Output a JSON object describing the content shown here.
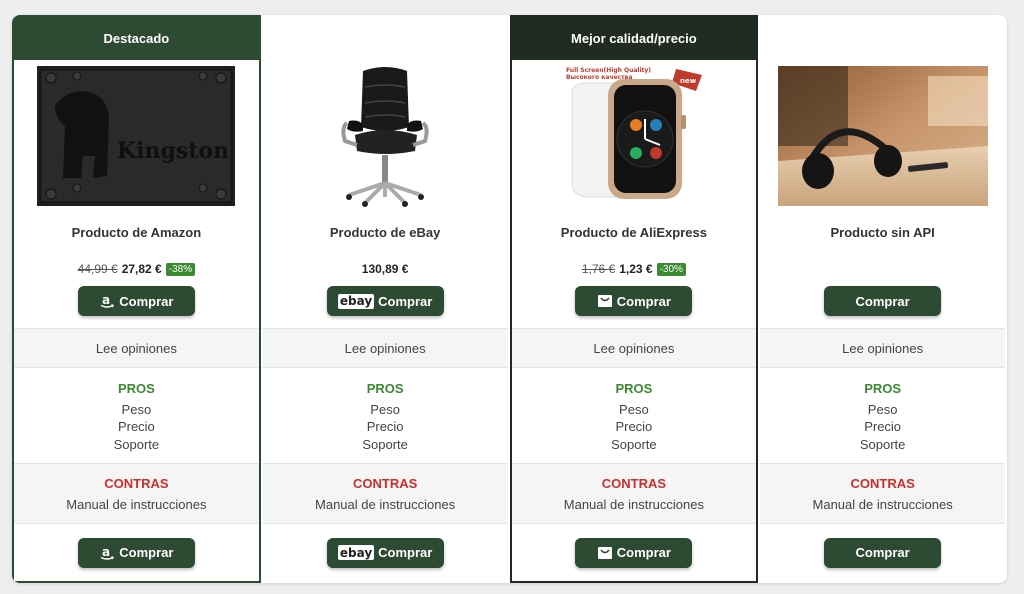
{
  "columns": [
    {
      "badge": "Destacado",
      "title": "Producto de Amazon",
      "old_price": "44,99 €",
      "price": "27,82 €",
      "discount": "-38%",
      "buy_label": "Comprar",
      "store_icon": "amazon-icon",
      "reviews": "Lee opiniones",
      "pros_title": "PROS",
      "pros": [
        "Peso",
        "Precio",
        "Soporte"
      ],
      "cons_title": "CONTRAS",
      "cons": [
        "Manual de instrucciones"
      ],
      "image": "kingston-ssd",
      "image_text": "Kingston"
    },
    {
      "badge": "",
      "title": "Producto de eBay",
      "old_price": "",
      "price": "130,89 €",
      "discount": "",
      "buy_label": "Comprar",
      "store_icon": "ebay-icon",
      "ebay_text": "ebay",
      "reviews": "Lee opiniones",
      "pros_title": "PROS",
      "pros": [
        "Peso",
        "Precio",
        "Soporte"
      ],
      "cons_title": "CONTRAS",
      "cons": [
        "Manual de instrucciones"
      ],
      "image": "office-chair"
    },
    {
      "badge": "Mejor calidad/precio",
      "title": "Producto de AliExpress",
      "old_price": "1,76 €",
      "price": "1,23 €",
      "discount": "-30%",
      "buy_label": "Comprar",
      "store_icon": "aliexpress-bag-icon",
      "reviews": "Lee opiniones",
      "pros_title": "PROS",
      "pros": [
        "Peso",
        "Precio",
        "Soporte"
      ],
      "cons_title": "CONTRAS",
      "cons": [
        "Manual de instrucciones"
      ],
      "image": "smartwatch",
      "image_text_1": "Full Screen(High Quality)",
      "image_text_2": "Высокого качества",
      "image_text_3": "new"
    },
    {
      "badge": "",
      "title": "Producto sin API",
      "old_price": "",
      "price": "",
      "discount": "",
      "buy_label": "Comprar",
      "store_icon": "",
      "reviews": "Lee opiniones",
      "pros_title": "PROS",
      "pros": [
        "Peso",
        "Precio",
        "Soporte"
      ],
      "cons_title": "CONTRAS",
      "cons": [
        "Manual de instrucciones"
      ],
      "image": "headphones-desk"
    }
  ],
  "colors": {
    "brand_green": "#2d4a33",
    "dark_header": "#202b22",
    "pros_green": "#3a8a2f",
    "cons_red": "#c9302c"
  }
}
